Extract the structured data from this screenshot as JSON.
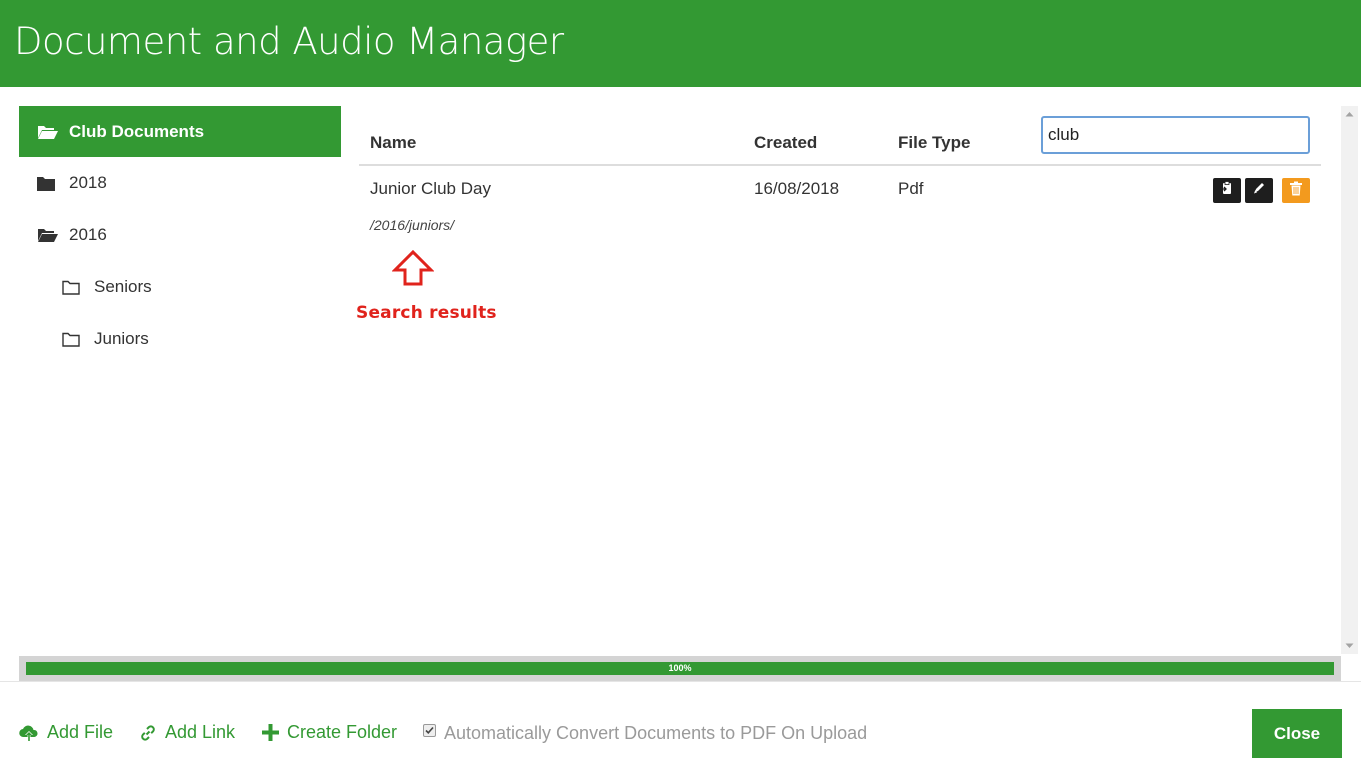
{
  "header": {
    "title": "Document and Audio Manager"
  },
  "sidebar": {
    "items": [
      {
        "label": "Club Documents"
      },
      {
        "label": "2018"
      },
      {
        "label": "2016"
      },
      {
        "label": "Seniors"
      },
      {
        "label": "Juniors"
      }
    ]
  },
  "table": {
    "columns": [
      "Name",
      "Created",
      "File Type"
    ],
    "rows": [
      {
        "name": "Junior Club Day",
        "created": "16/08/2018",
        "type": "Pdf",
        "path": "/2016/juniors/"
      }
    ]
  },
  "search": {
    "value": "club"
  },
  "annotation": {
    "text": "Search results"
  },
  "progress": {
    "percent": 100,
    "label": "100%"
  },
  "footer": {
    "add_file": "Add File",
    "add_link": "Add Link",
    "create_folder": "Create Folder",
    "auto_convert": "Automatically Convert Documents to PDF On Upload",
    "close": "Close"
  },
  "colors": {
    "brand": "#339933",
    "accent_orange": "#f39a1e",
    "annotation_red": "#e0231c"
  }
}
